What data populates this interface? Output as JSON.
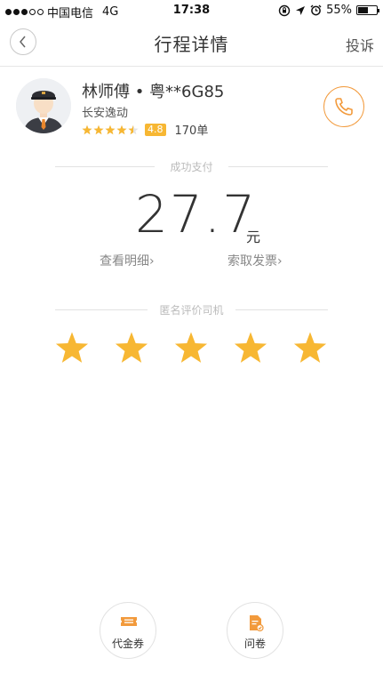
{
  "status_bar": {
    "carrier": "中国电信",
    "network": "4G",
    "time": "17:38",
    "battery": "55%",
    "battery_level": 0.55
  },
  "nav": {
    "title": "行程详情",
    "complain_label": "投诉"
  },
  "driver": {
    "name": "林师傅 • 粤**6G85",
    "company": "长安逸动",
    "rating": "4.8",
    "rating_stars": 4.5,
    "orders": "170单"
  },
  "payment": {
    "status_label": "成功支付",
    "amount": "27.7",
    "currency": "元",
    "details_link": "查看明细›",
    "invoice_link": "索取发票›"
  },
  "evaluation": {
    "label": "匿名评价司机",
    "stars": 5
  },
  "bottom_actions": {
    "voucher_label": "代金券",
    "survey_label": "问卷"
  },
  "colors": {
    "accent": "#f29a3c",
    "star": "#f7b733",
    "divider": "#e2e2e2"
  }
}
